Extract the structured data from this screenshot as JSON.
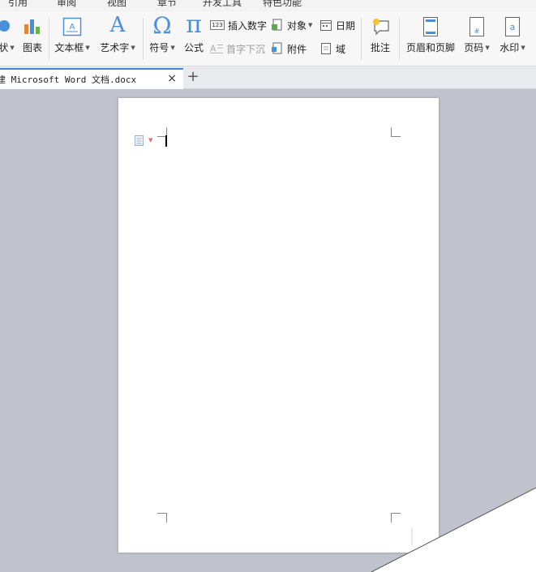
{
  "menubar": {
    "items": [
      "引用",
      "审阅",
      "视图",
      "章节",
      "开发工具",
      "特色功能"
    ]
  },
  "ribbon": {
    "shape_label": "状",
    "chart_label": "图表",
    "textbox_label": "文本框",
    "wordart_label": "艺术字",
    "symbol_label": "符号",
    "formula_label": "公式",
    "insert_number_label": "插入数字",
    "dropcap_label": "首字下沉",
    "object_label": "对象",
    "attachment_label": "附件",
    "date_label": "日期",
    "field_label": "域",
    "comment_label": "批注",
    "header_footer_label": "页眉和页脚",
    "page_number_label": "页码",
    "watermark_label": "水印",
    "wordart_glyph": "A",
    "symbol_glyph": "Ω",
    "formula_glyph": "π",
    "insert_number_glyph": "123"
  },
  "tabs": {
    "document_title": "建 Microsoft Word 文档.docx",
    "close_glyph": "×",
    "add_glyph": "+"
  },
  "colors": {
    "accent": "#3c8be0",
    "workspace": "#c0c3cb",
    "page": "#ffffff"
  }
}
